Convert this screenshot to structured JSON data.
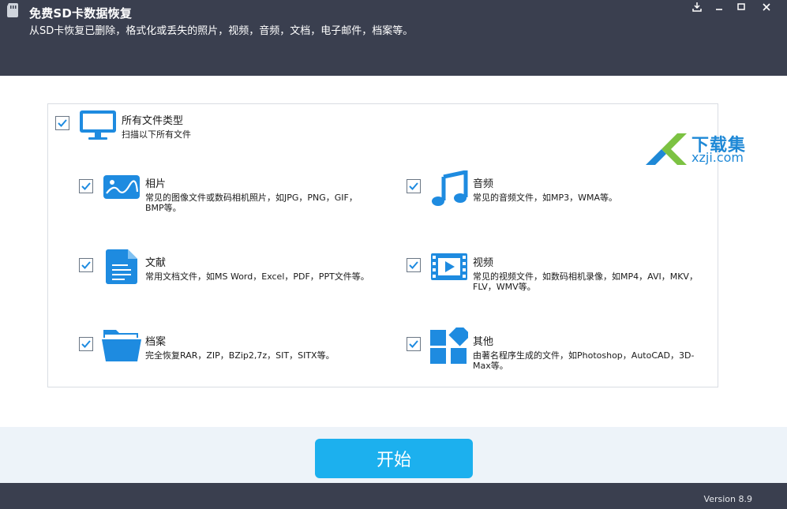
{
  "header": {
    "title": "免费SD卡数据恢复",
    "subtitle": "从SD卡恢复已删除，格式化或丢失的照片，视频，音频，文档，电子邮件，档案等。",
    "controls": [
      "download-icon",
      "minimize-icon",
      "maximize-icon",
      "close-icon"
    ]
  },
  "all_types": {
    "title": "所有文件类型",
    "desc": "扫描以下所有文件",
    "checked": true,
    "icon": "monitor-icon"
  },
  "options": [
    {
      "title": "相片",
      "desc": "常见的图像文件或数码相机照片，如JPG，PNG，GIF，BMP等。",
      "icon": "image-icon",
      "checked": true
    },
    {
      "title": "音频",
      "desc": "常见的音频文件，如MP3，WMA等。",
      "icon": "music-icon",
      "checked": true
    },
    {
      "title": "文献",
      "desc": "常用文档文件，如MS Word，Excel，PDF，PPT文件等。",
      "icon": "document-icon",
      "checked": true
    },
    {
      "title": "视频",
      "desc": "常见的视频文件，如数码相机录像，如MP4，AVI，MKV，FLV，WMV等。",
      "icon": "video-icon",
      "checked": true
    },
    {
      "title": "档案",
      "desc": "完全恢复RAR，ZIP，BZip2,7z，SIT，SITX等。",
      "icon": "folder-icon",
      "checked": true
    },
    {
      "title": "其他",
      "desc": "由著名程序生成的文件，如Photoshop，AutoCAD，3D-Max等。",
      "icon": "apps-icon",
      "checked": true
    }
  ],
  "watermark": {
    "line1": "下载集",
    "line2": "xzji.com"
  },
  "start_button": "开始",
  "version": "Version 8.9",
  "colors": {
    "header_bg": "#3a3f4f",
    "accent": "#1cb0ee",
    "icon_blue": "#1e8be0"
  }
}
